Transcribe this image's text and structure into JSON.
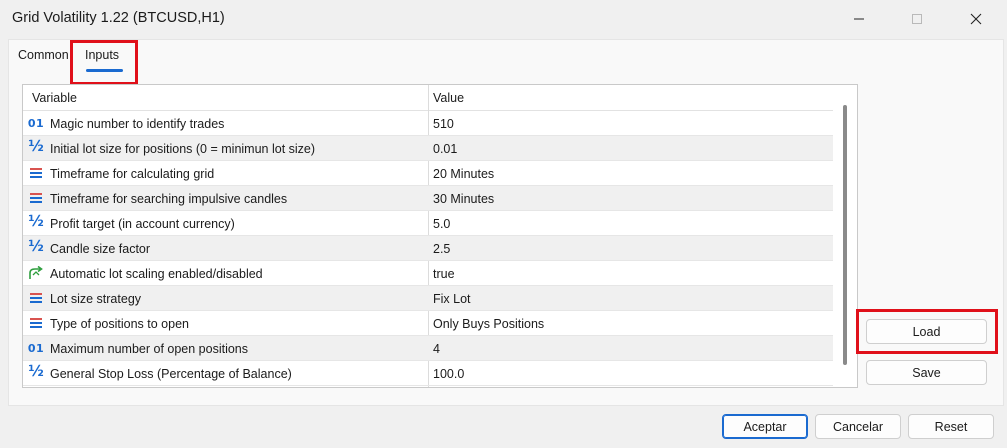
{
  "window": {
    "title": "Grid Volatility 1.22 (BTCUSD,H1)"
  },
  "tabs": [
    {
      "label": "Common"
    },
    {
      "label": "Inputs"
    }
  ],
  "grid": {
    "headers": {
      "variable": "Variable",
      "value": "Value"
    },
    "rows": [
      {
        "icon": "integer-icon",
        "variable": "Magic number to identify trades",
        "value": "510"
      },
      {
        "icon": "fraction-icon",
        "variable": "Initial lot size for positions (0 = minimun lot size)",
        "value": "0.01"
      },
      {
        "icon": "enum-list-icon",
        "variable": "Timeframe for calculating grid",
        "value": "20 Minutes"
      },
      {
        "icon": "enum-list-icon",
        "variable": "Timeframe for searching impulsive candles",
        "value": "30 Minutes"
      },
      {
        "icon": "fraction-icon",
        "variable": "Profit target (in account currency)",
        "value": "5.0"
      },
      {
        "icon": "fraction-icon",
        "variable": "Candle size factor",
        "value": "2.5"
      },
      {
        "icon": "boolean-arrow-icon",
        "variable": "Automatic lot scaling enabled/disabled",
        "value": "true"
      },
      {
        "icon": "enum-list-icon",
        "variable": "Lot size strategy",
        "value": "Fix Lot"
      },
      {
        "icon": "enum-list-icon",
        "variable": "Type of positions to open",
        "value": "Only Buys Positions"
      },
      {
        "icon": "integer-icon",
        "variable": "Maximum number of open positions",
        "value": "4"
      },
      {
        "icon": "fraction-icon",
        "variable": "General Stop Loss (Percentage of Balance)",
        "value": "100.0"
      }
    ]
  },
  "side_buttons": {
    "load": "Load",
    "save": "Save"
  },
  "footer_buttons": {
    "ok": "Aceptar",
    "cancel": "Cancelar",
    "reset": "Reset"
  },
  "icons": {
    "integer": "01",
    "fraction": "½"
  },
  "colors": {
    "accent": "#1a6ad0",
    "highlight": "#e0101a",
    "enum_icon_red": "#d9534f",
    "bool_icon_green": "#2e9e3e"
  }
}
